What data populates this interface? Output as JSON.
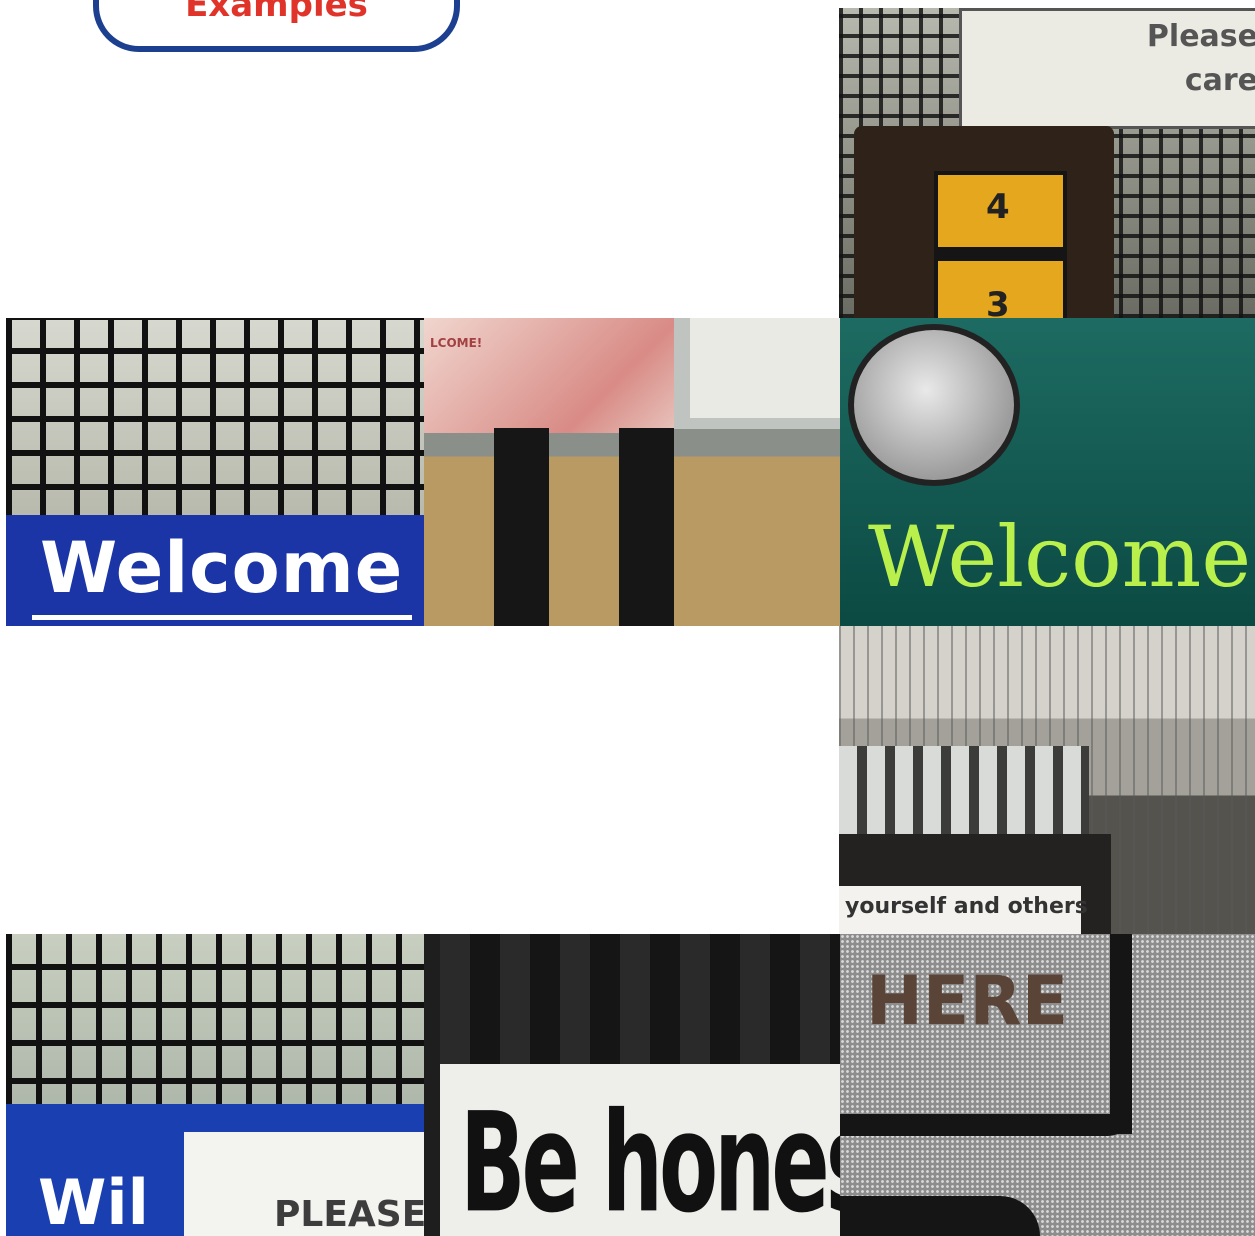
{
  "header": {
    "badge_label": "Examples"
  },
  "photos": [
    {
      "id": "top-right",
      "texts": [
        "Please",
        "care",
        "4",
        "3"
      ]
    },
    {
      "id": "blue-welcome",
      "texts": [
        "Welcome"
      ]
    },
    {
      "id": "clear-bag",
      "texts": [
        "LCOME!"
      ]
    },
    {
      "id": "green-welcome",
      "texts": [
        "Welcome"
      ]
    },
    {
      "id": "building-site",
      "texts": [
        "yourself and others"
      ]
    },
    {
      "id": "blue-will",
      "texts": [
        "Wil",
        "PLEASE"
      ]
    },
    {
      "id": "be-honest",
      "texts": [
        "Be honest"
      ]
    },
    {
      "id": "here",
      "texts": [
        "HERE"
      ]
    }
  ],
  "colors": {
    "badge_border": "#1c3f8f",
    "badge_text": "#e0342a"
  }
}
